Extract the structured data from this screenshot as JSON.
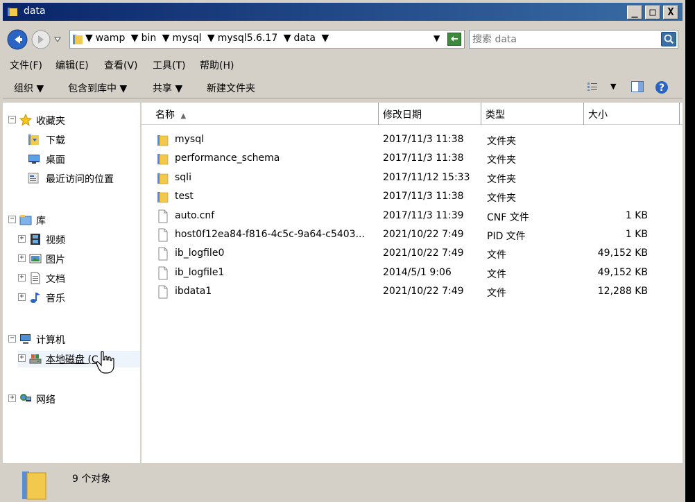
{
  "window": {
    "title": "data",
    "controls": {
      "minimize": "_",
      "maximize": "□",
      "close": "X"
    }
  },
  "address": {
    "crumbs": [
      "wamp",
      "bin",
      "mysql",
      "mysql5.6.17",
      "data"
    ],
    "search_placeholder": "搜索 data"
  },
  "menu": {
    "items": [
      "文件(F)",
      "编辑(E)",
      "查看(V)",
      "工具(T)",
      "帮助(H)"
    ]
  },
  "commands": {
    "organize": "组织 ▼",
    "include_library": "包含到库中 ▼",
    "share": "共享 ▼",
    "new_folder": "新建文件夹"
  },
  "nav": {
    "favorites": "收藏夹",
    "downloads": "下载",
    "desktop": "桌面",
    "recent": "最近访问的位置",
    "libraries": "库",
    "videos": "视频",
    "pictures": "图片",
    "documents": "文档",
    "music": "音乐",
    "computer": "计算机",
    "local_disk": "本地磁盘 (C",
    "network": "网络"
  },
  "columns": {
    "name": "名称",
    "sort_arrow": "▲",
    "date": "修改日期",
    "type": "类型",
    "size": "大小"
  },
  "files": [
    {
      "name": "mysql",
      "date": "2017/11/3 11:38",
      "type": "文件夹",
      "size": "",
      "kind": "folder"
    },
    {
      "name": "performance_schema",
      "date": "2017/11/3 11:38",
      "type": "文件夹",
      "size": "",
      "kind": "folder"
    },
    {
      "name": "sqli",
      "date": "2017/11/12 15:33",
      "type": "文件夹",
      "size": "",
      "kind": "folder"
    },
    {
      "name": "test",
      "date": "2017/11/3 11:38",
      "type": "文件夹",
      "size": "",
      "kind": "folder"
    },
    {
      "name": "auto.cnf",
      "date": "2017/11/3 11:39",
      "type": "CNF 文件",
      "size": "1 KB",
      "kind": "file"
    },
    {
      "name": "host0f12ea84-f816-4c5c-9a64-c5403...",
      "date": "2021/10/22 7:49",
      "type": "PID 文件",
      "size": "1 KB",
      "kind": "file"
    },
    {
      "name": "ib_logfile0",
      "date": "2021/10/22 7:49",
      "type": "文件",
      "size": "49,152 KB",
      "kind": "file"
    },
    {
      "name": "ib_logfile1",
      "date": "2014/5/1 9:06",
      "type": "文件",
      "size": "49,152 KB",
      "kind": "file"
    },
    {
      "name": "ibdata1",
      "date": "2021/10/22 7:49",
      "type": "文件",
      "size": "12,288 KB",
      "kind": "file"
    }
  ],
  "status": {
    "count": "9 个对象"
  },
  "colors": {
    "title_start": "#0a246a",
    "title_end": "#3a6ea5",
    "chrome": "#d4d0c8",
    "folder": "#f2c94c"
  },
  "icons": {
    "folder": "folder-icon",
    "file": "file-icon",
    "favorites": "star-icon",
    "search": "search-icon"
  }
}
